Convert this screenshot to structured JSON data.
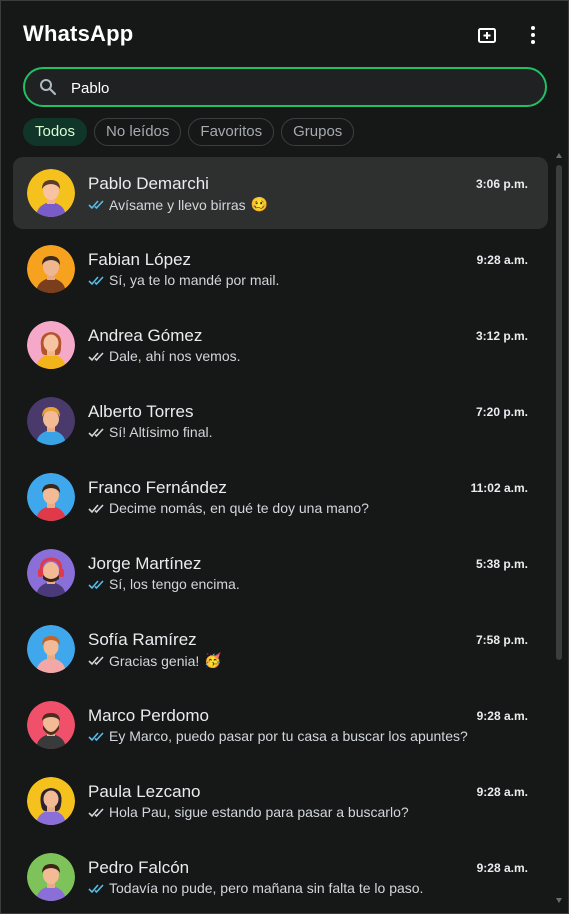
{
  "app": {
    "title": "WhatsApp"
  },
  "icons": {
    "new_chat": "new-chat-icon",
    "menu": "more-vertical-icon",
    "search": "search-icon",
    "read": "double-check-icon"
  },
  "colors": {
    "accent": "#21c063",
    "read_tick": "#53bdeb",
    "sent_tick": "#d1d7db",
    "selected_row": "#2e2f2f"
  },
  "search": {
    "value": "Pablo",
    "placeholder": ""
  },
  "filters": [
    {
      "label": "Todos",
      "active": true
    },
    {
      "label": "No leídos",
      "active": false
    },
    {
      "label": "Favoritos",
      "active": false
    },
    {
      "label": "Grupos",
      "active": false
    }
  ],
  "chats": [
    {
      "name": "Pablo Demarchi",
      "time": "3:06 p.m.",
      "preview": "Avísame y llevo birras",
      "emoji": "🥴",
      "read": true,
      "selected": true
    },
    {
      "name": "Fabian López",
      "time": "9:28 a.m.",
      "preview": "Sí, ya te lo mandé por mail.",
      "emoji": "",
      "read": true,
      "selected": false
    },
    {
      "name": "Andrea Gómez",
      "time": "3:12 p.m.",
      "preview": "Dale, ahí nos vemos.",
      "emoji": "",
      "read": false,
      "selected": false
    },
    {
      "name": "Alberto Torres",
      "time": "7:20 p.m.",
      "preview": "Sí! Altísimo final.",
      "emoji": "",
      "read": false,
      "selected": false
    },
    {
      "name": "Franco Fernández",
      "time": "11:02 a.m.",
      "preview": "Decime nomás, en qué te doy una mano?",
      "emoji": "",
      "read": false,
      "selected": false
    },
    {
      "name": "Jorge Martínez",
      "time": "5:38 p.m.",
      "preview": "Sí, los tengo encima.",
      "emoji": "",
      "read": true,
      "selected": false
    },
    {
      "name": "Sofía Ramírez",
      "time": "7:58 p.m.",
      "preview": "Gracias genia!",
      "emoji": "🥳",
      "read": false,
      "selected": false
    },
    {
      "name": "Marco Perdomo",
      "time": "9:28 a.m.",
      "preview": "Ey Marco, puedo pasar por tu casa a buscar los apuntes?",
      "emoji": "",
      "read": true,
      "selected": false
    },
    {
      "name": "Paula Lezcano",
      "time": "9:28 a.m.",
      "preview": "Hola Pau, sigue estando para pasar a buscarlo?",
      "emoji": "",
      "read": false,
      "selected": false
    },
    {
      "name": "Pedro Falcón",
      "time": "9:28 a.m.",
      "preview": "Todavía no pude, pero mañana sin falta te lo paso.",
      "emoji": "",
      "read": true,
      "selected": false
    }
  ]
}
